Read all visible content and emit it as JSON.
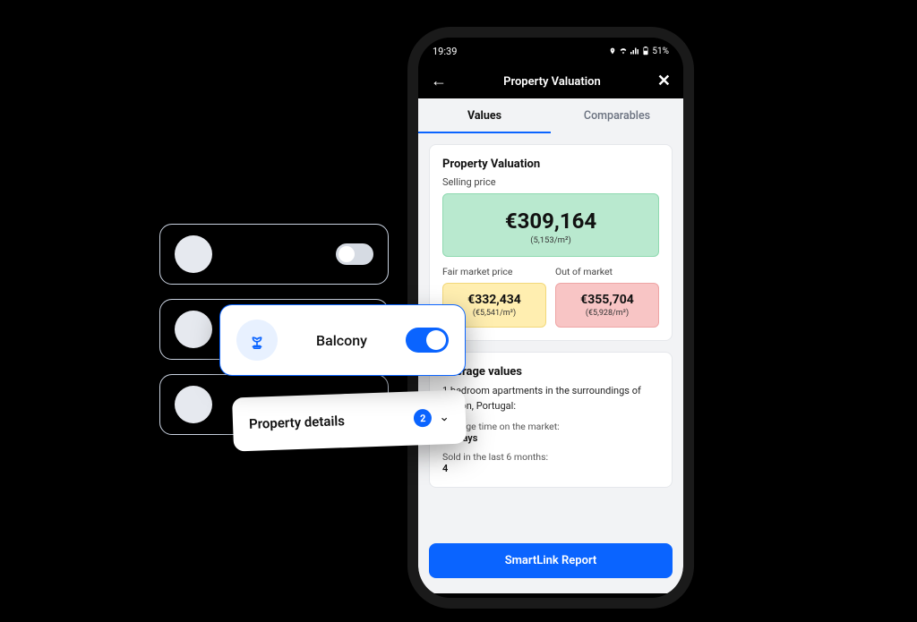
{
  "status": {
    "time": "19:39",
    "battery": "51%"
  },
  "header": {
    "title": "Property Valuation"
  },
  "tabs": {
    "values": "Values",
    "comparables": "Comparables"
  },
  "valuation": {
    "title": "Property Valuation",
    "selling_label": "Selling price",
    "selling_price": "€309,164",
    "selling_per": "(5,153/m²)",
    "fair_label": "Fair market price",
    "fair_price": "€332,434",
    "fair_per": "(€5,541/m²)",
    "out_label": "Out of market",
    "out_price": "€355,704",
    "out_per": "(€5,928/m²)"
  },
  "averages": {
    "title": "Average values",
    "intro": "1 bedroom apartments in the surroundings of Lisbon, Portugal:",
    "time_label": "Average time on the market:",
    "time_value": "97 Days",
    "sold_label": "Sold in the last 6 months:",
    "sold_value": "4"
  },
  "cta": {
    "smartlink": "SmartLink Report"
  },
  "floating": {
    "balcony": "Balcony",
    "details": "Property details",
    "details_badge": "2"
  }
}
